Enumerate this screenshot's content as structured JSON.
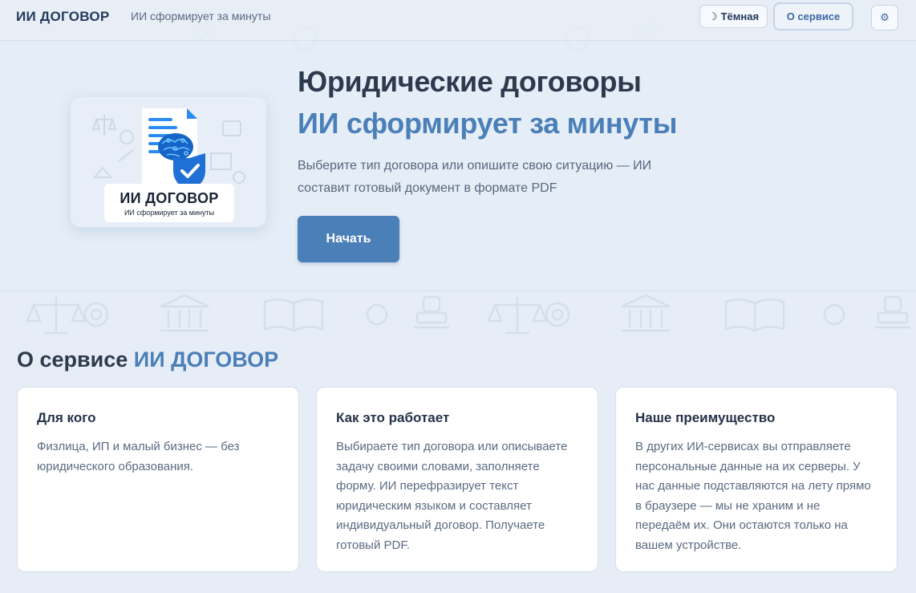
{
  "header": {
    "brand": "ИИ ДОГОВОР",
    "tagline": "ИИ сформирует за минуты",
    "theme_icon": "☽",
    "theme_label": "Тёмная",
    "about_label": "О сервисе",
    "settings_icon": "⚙"
  },
  "hero": {
    "logo": {
      "name": "ИИ ДОГОВОР",
      "subtitle": "ИИ сформирует за минуты"
    },
    "title_line1": "Юридические договоры",
    "title_line2": "ИИ сформирует за минуты",
    "description": "Выберите тип договора или опишите свою ситуацию — ИИ составит готовый документ в формате PDF",
    "start_label": "Начать"
  },
  "about": {
    "title_prefix": "О сервисе",
    "title_accent": "ИИ ДОГОВОР",
    "cards": [
      {
        "title": "Для кого",
        "text": "Физлица, ИП и малый бизнес — без юридического образования."
      },
      {
        "title": "Как это работает",
        "text": "Выбираете тип договора или описываете задачу своими словами, заполняете форму. ИИ перефразирует текст юридическим языком и составляет индивидуальный договор. Получаете готовый PDF."
      },
      {
        "title": "Наше преимущество",
        "text": "В других ИИ-сервисах вы отправляете персональные данные на их серверы. У нас данные подставляются на лету прямо в браузере — мы не храним и не передаём их. Они остаются только на вашем устройстве."
      }
    ]
  },
  "colors": {
    "accent": "#4a7fb8",
    "background": "#e6edf6",
    "heading": "#2d3a4d",
    "body_text": "#5a6a80"
  }
}
